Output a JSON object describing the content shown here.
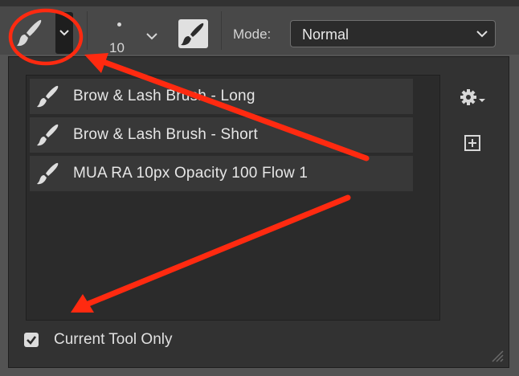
{
  "toolbar": {
    "brush_size": "10",
    "mode_label": "Mode:",
    "mode_value": "Normal"
  },
  "preset_picker": {
    "presets": [
      {
        "label": "Brow & Lash Brush - Long"
      },
      {
        "label": "Brow & Lash Brush - Short"
      },
      {
        "label": "MUA RA 10px Opacity 100 Flow 1"
      }
    ],
    "current_tool_only": {
      "label": "Current Tool Only",
      "checked": true
    }
  },
  "icons": {
    "tool": "brush-icon",
    "preset_dropdown": "chevron-down-icon",
    "size_dropdown": "chevron-down-icon",
    "panel_toggle": "brush-panel-icon",
    "settings": "gear-icon",
    "new_preset": "plus-square-icon",
    "preset_item": "brush-icon",
    "checkbox": "checkmark-icon",
    "resize": "resize-grip-icon"
  },
  "colors": {
    "annotation_red": "#ff2a10",
    "toolbar_bg": "#484848",
    "panel_bg": "#323232"
  }
}
